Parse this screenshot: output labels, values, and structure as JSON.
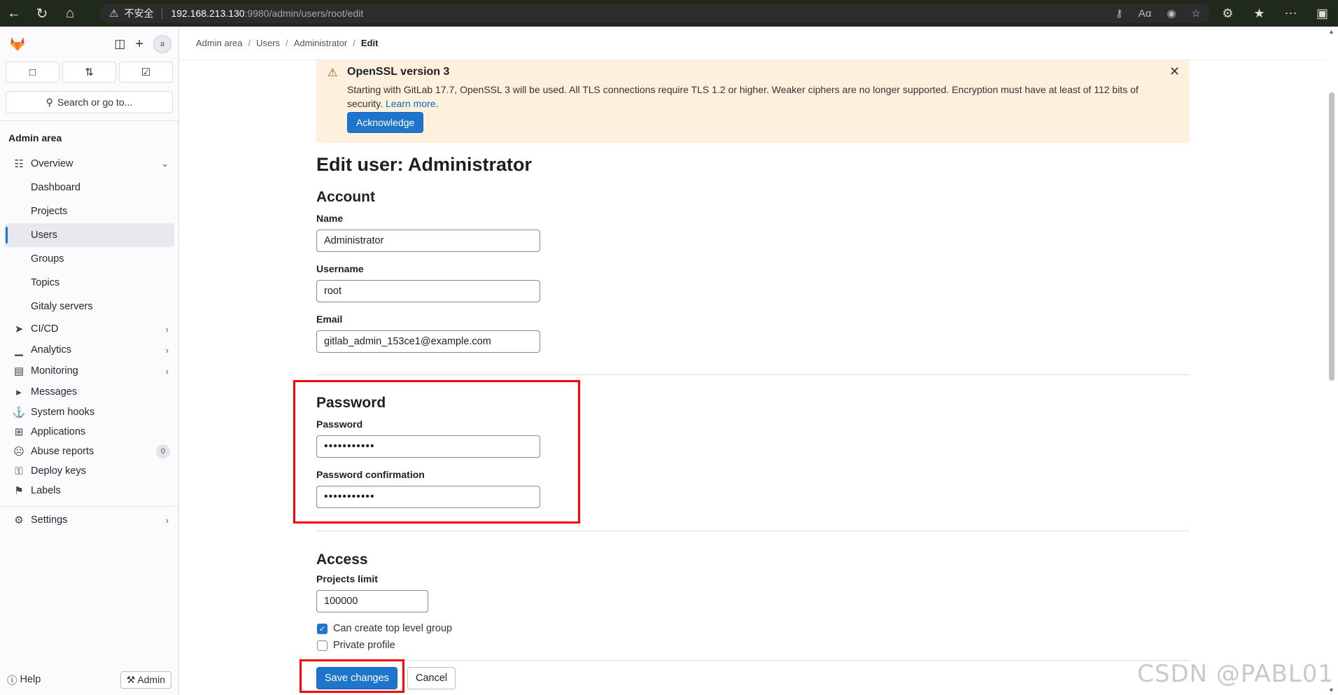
{
  "browser": {
    "insecure_label": "不安全",
    "url_host": "192.168.213.130",
    "url_path": ":9980/admin/users/root/edit"
  },
  "sidebar": {
    "avatar_text": "a",
    "search_label": "Search or go to...",
    "section_title": "Admin area",
    "items": [
      {
        "label": "Overview"
      },
      {
        "label": "Dashboard"
      },
      {
        "label": "Projects"
      },
      {
        "label": "Users"
      },
      {
        "label": "Groups"
      },
      {
        "label": "Topics"
      },
      {
        "label": "Gitaly servers"
      },
      {
        "label": "CI/CD"
      },
      {
        "label": "Analytics"
      },
      {
        "label": "Monitoring"
      },
      {
        "label": "Messages"
      },
      {
        "label": "System hooks"
      },
      {
        "label": "Applications"
      },
      {
        "label": "Abuse reports",
        "badge": "0"
      },
      {
        "label": "Deploy keys"
      },
      {
        "label": "Labels"
      },
      {
        "label": "Settings"
      }
    ],
    "help_label": "Help",
    "admin_label": "Admin"
  },
  "breadcrumb": {
    "items": [
      "Admin area",
      "Users",
      "Administrator",
      "Edit"
    ]
  },
  "alert": {
    "title": "OpenSSL version 3",
    "body": "Starting with GitLab 17.7, OpenSSL 3 will be used. All TLS connections require TLS 1.2 or higher. Weaker ciphers are no longer supported. Encryption must have at least of 112 bits of security.",
    "link": "Learn more",
    "button": "Acknowledge"
  },
  "form": {
    "title": "Edit user: Administrator",
    "account_heading": "Account",
    "name_label": "Name",
    "name_value": "Administrator",
    "username_label": "Username",
    "username_value": "root",
    "email_label": "Email",
    "email_value": "gitlab_admin_153ce1@example.com",
    "password_heading": "Password",
    "password_label": "Password",
    "password_value": "•••••••••••",
    "password_confirm_label": "Password confirmation",
    "password_confirm_value": "•••••••••••",
    "access_heading": "Access",
    "projects_limit_label": "Projects limit",
    "projects_limit_value": "100000",
    "can_create_group_label": "Can create top level group",
    "can_create_group_checked": true,
    "private_profile_label": "Private profile",
    "private_profile_checked": false,
    "save_button": "Save changes",
    "cancel_button": "Cancel"
  },
  "watermark": "CSDN @PABL01",
  "colors": {
    "primary": "#1f75cb",
    "alert_bg": "#fdf1dd",
    "highlight": "#ff0000"
  }
}
